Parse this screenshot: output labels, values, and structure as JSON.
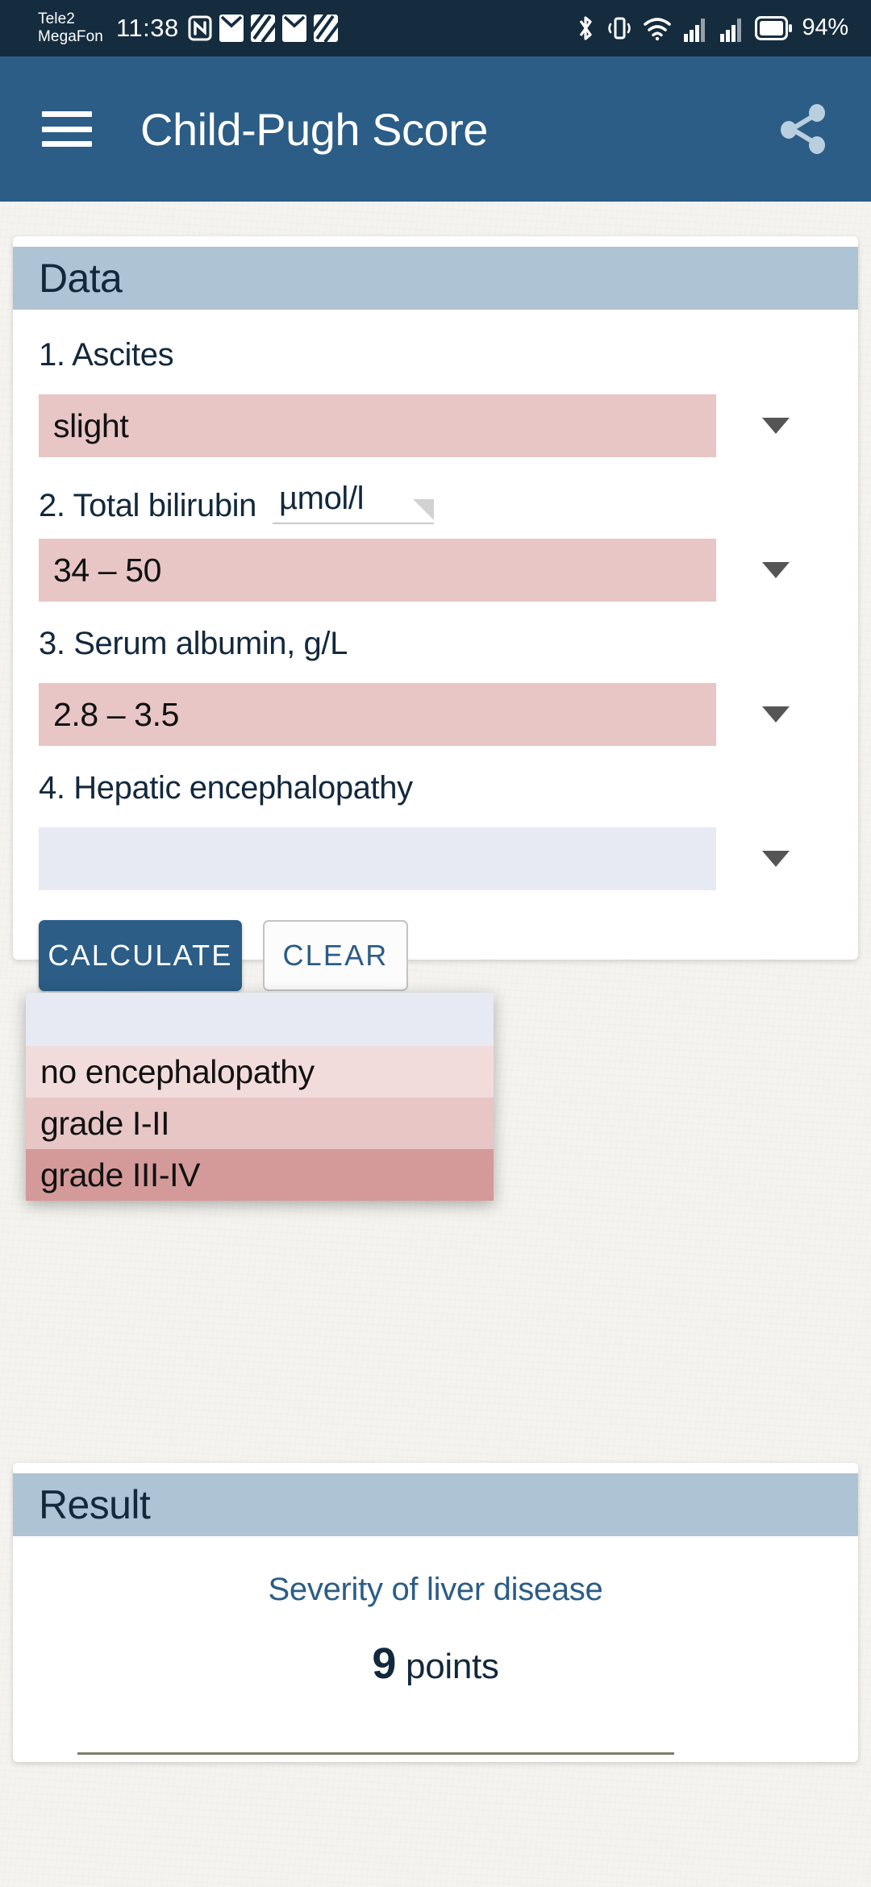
{
  "status_bar": {
    "carrier_line1": "Tele2",
    "carrier_line2": "MegaFon",
    "time": "11:38",
    "battery_percent": "94%",
    "left_icons": [
      "nfc-icon",
      "mail-icon",
      "app-icon",
      "mail-icon",
      "app-icon"
    ],
    "right_icons": [
      "bluetooth-icon",
      "vibrate-icon",
      "wifi-icon",
      "signal-bars-icon",
      "signal-bars-icon",
      "battery-icon"
    ],
    "background_color": "#152c3f"
  },
  "app_bar": {
    "title": "Child-Pugh Score",
    "menu_icon": "hamburger-menu-icon",
    "share_icon": "share-icon",
    "background_color": "#2b5d86"
  },
  "data_card": {
    "header": "Data",
    "header_color": "#aec3d3",
    "fields": [
      {
        "label": "1. Ascites",
        "value": "slight",
        "fill_color": "#e7c6c5"
      },
      {
        "label": "2. Total bilirubin",
        "unit": "µmol/l",
        "value": "34 – 50",
        "fill_color": "#e7c6c5"
      },
      {
        "label": "3. Serum albumin, g/L",
        "value": "2.8 – 3.5",
        "fill_color": "#e7c6c5"
      },
      {
        "label": "4. Hepatic encephalopathy",
        "value": "",
        "fill_color": "#e7eaf2"
      }
    ],
    "open_dropdown": {
      "for_field": "4. Hepatic encephalopathy",
      "selected_blank": "",
      "options": [
        {
          "label": "no encephalopathy",
          "color": "#f2dcdb"
        },
        {
          "label": "grade I-II",
          "color": "#e7c6c5"
        },
        {
          "label": "grade III-IV",
          "color": "#d49a9a"
        }
      ]
    },
    "buttons": {
      "calculate": "CALCULATE",
      "clear": "CLEAR",
      "primary_color": "#2b5d86"
    }
  },
  "result_card": {
    "header": "Result",
    "caption": "Severity of liver disease",
    "score": "9",
    "score_unit": "points",
    "caption_color": "#2b5d86"
  }
}
